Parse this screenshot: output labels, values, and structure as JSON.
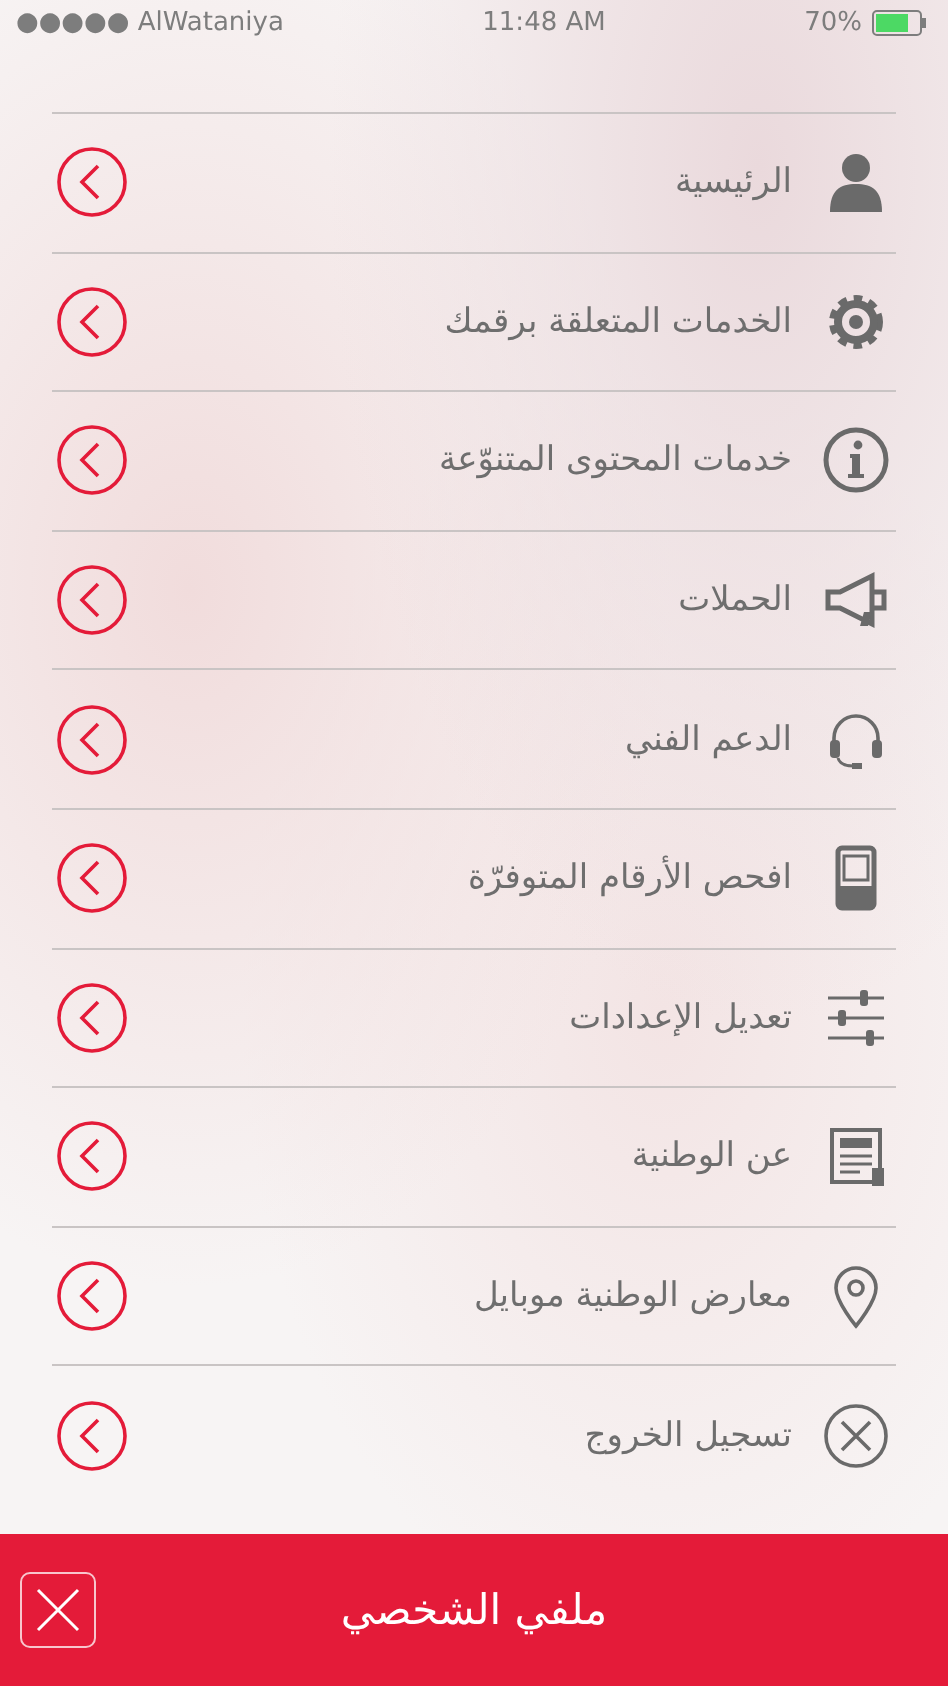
{
  "status_bar": {
    "carrier": "●●●●● AlWataniya",
    "time": "11:48 AM",
    "battery": "70%"
  },
  "menu": {
    "items": [
      {
        "label": "الرئيسية"
      },
      {
        "label": "الخدمات المتعلقة برقمك"
      },
      {
        "label": "خدمات المحتوى المتنوّعة"
      },
      {
        "label": "الحملات"
      },
      {
        "label": "الدعم الفني"
      },
      {
        "label": "افحص الأرقام المتوفرّة"
      },
      {
        "label": "تعديل الإعدادات"
      },
      {
        "label": "عن الوطنية"
      },
      {
        "label": "معارض الوطنية موبايل"
      },
      {
        "label": "تسجيل الخروج"
      }
    ]
  },
  "footer": {
    "title": "ملفي الشخصي"
  }
}
